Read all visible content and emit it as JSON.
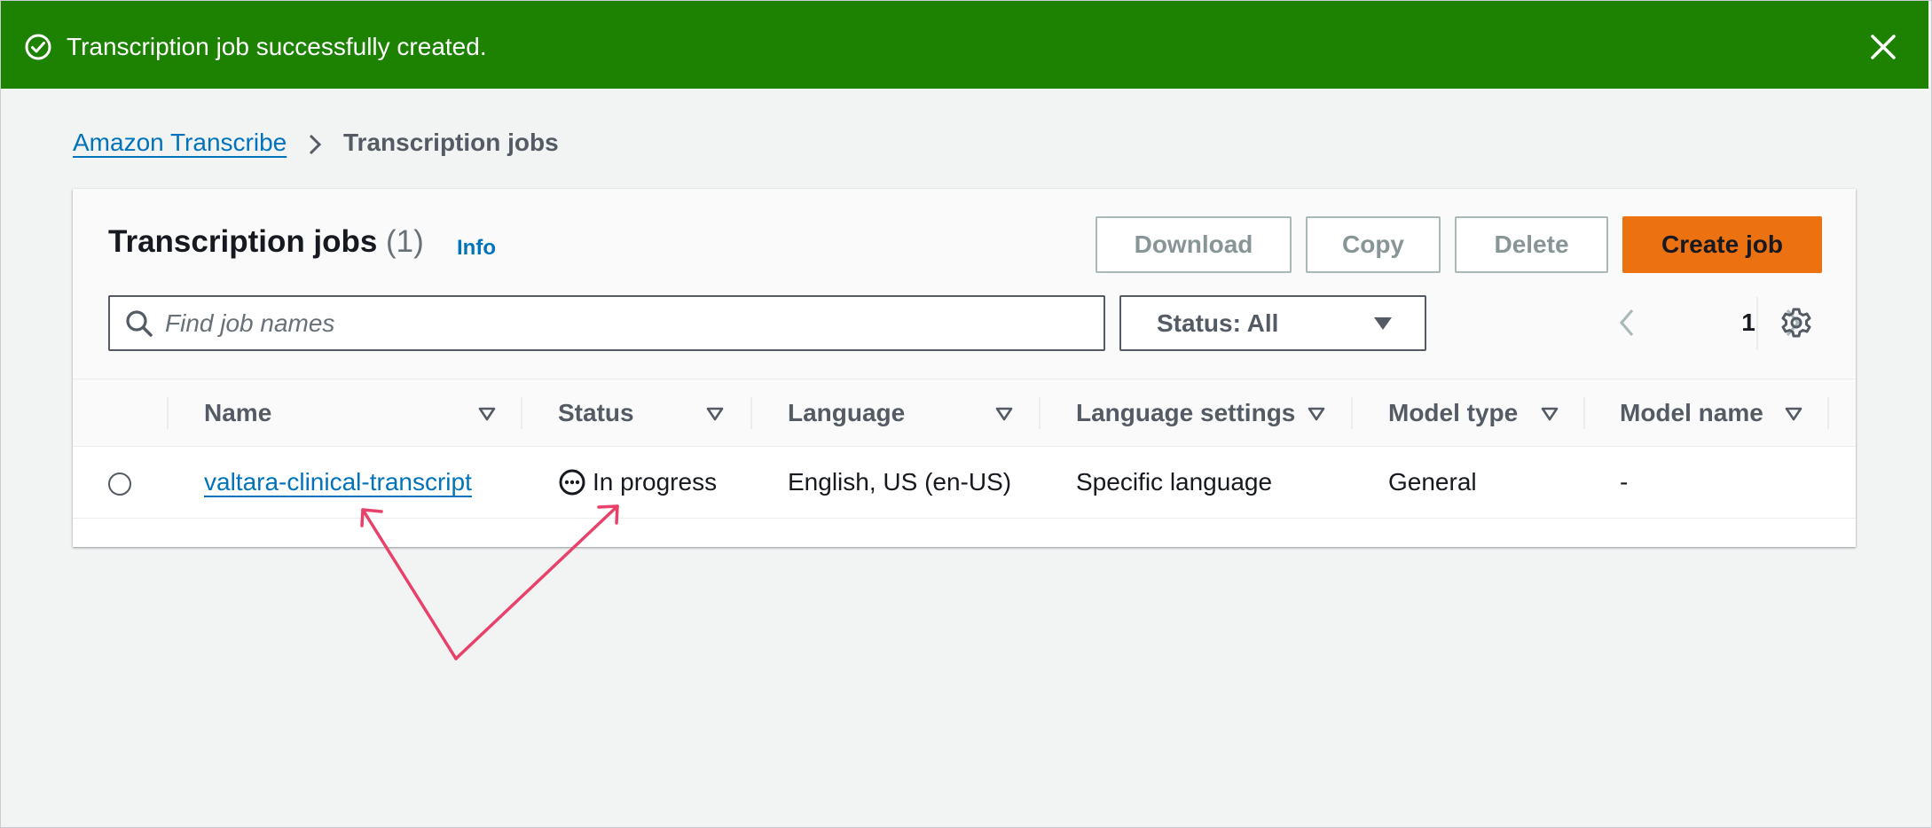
{
  "flash": {
    "message": "Transcription job successfully created.",
    "color": "#1d8102"
  },
  "breadcrumb": {
    "parent": "Amazon Transcribe",
    "current": "Transcription jobs"
  },
  "panel": {
    "title": "Transcription jobs",
    "count": "(1)",
    "info": "Info",
    "buttons": {
      "download": "Download",
      "copy": "Copy",
      "delete": "Delete",
      "create": "Create job"
    },
    "search": {
      "placeholder": "Find job names",
      "value": ""
    },
    "status_filter": "Status: All",
    "page": "1"
  },
  "table": {
    "columns": [
      "Name",
      "Status",
      "Language",
      "Language settings",
      "Model type",
      "Model name"
    ],
    "rows": [
      {
        "name": "valtara-clinical-transcript",
        "status": "In progress",
        "language": "English, US (en-US)",
        "language_settings": "Specific language",
        "model_type": "General",
        "model_name": "-"
      }
    ]
  },
  "colors": {
    "accent": "#ec7211",
    "link": "#0073bb",
    "annotation": "#e8416a"
  },
  "icons": {
    "flash": "check-circle-icon",
    "close": "close-icon",
    "breadcrumb_sep": "chevron-right-icon",
    "search": "search-icon",
    "filter": "caret-down-icon",
    "sort": "sort-caret-icon",
    "status": "in-progress-icon",
    "settings": "gear-icon"
  }
}
